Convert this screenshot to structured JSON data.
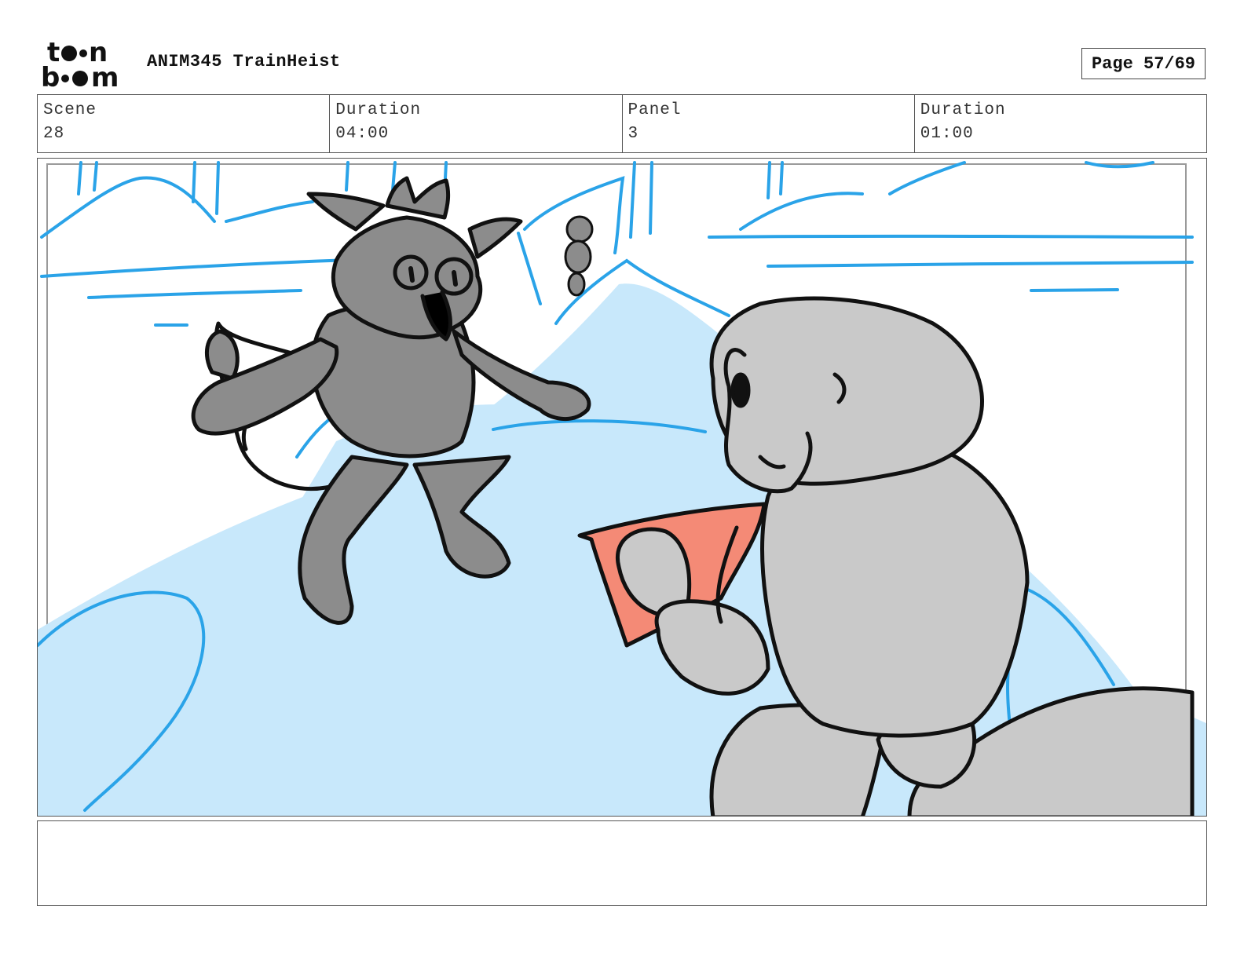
{
  "header": {
    "logo_text": "toon boom",
    "project_title": "ANIM345 TrainHeist",
    "page_label": "Page 57/69"
  },
  "info": {
    "scene_label": "Scene",
    "scene_value": "28",
    "scene_duration_label": "Duration",
    "scene_duration_value": "04:00",
    "panel_label": "Panel",
    "panel_value": "3",
    "panel_duration_label": "Duration",
    "panel_duration_value": "01:00"
  },
  "notes": {
    "text": ""
  },
  "colors": {
    "sky_lines": "#2aa3e8",
    "snow_fill": "#c8e8fb",
    "cat_fill": "#8c8c8c",
    "monkey_fill": "#c9c9c9",
    "bag_fill": "#f48a76",
    "ink": "#111111"
  }
}
